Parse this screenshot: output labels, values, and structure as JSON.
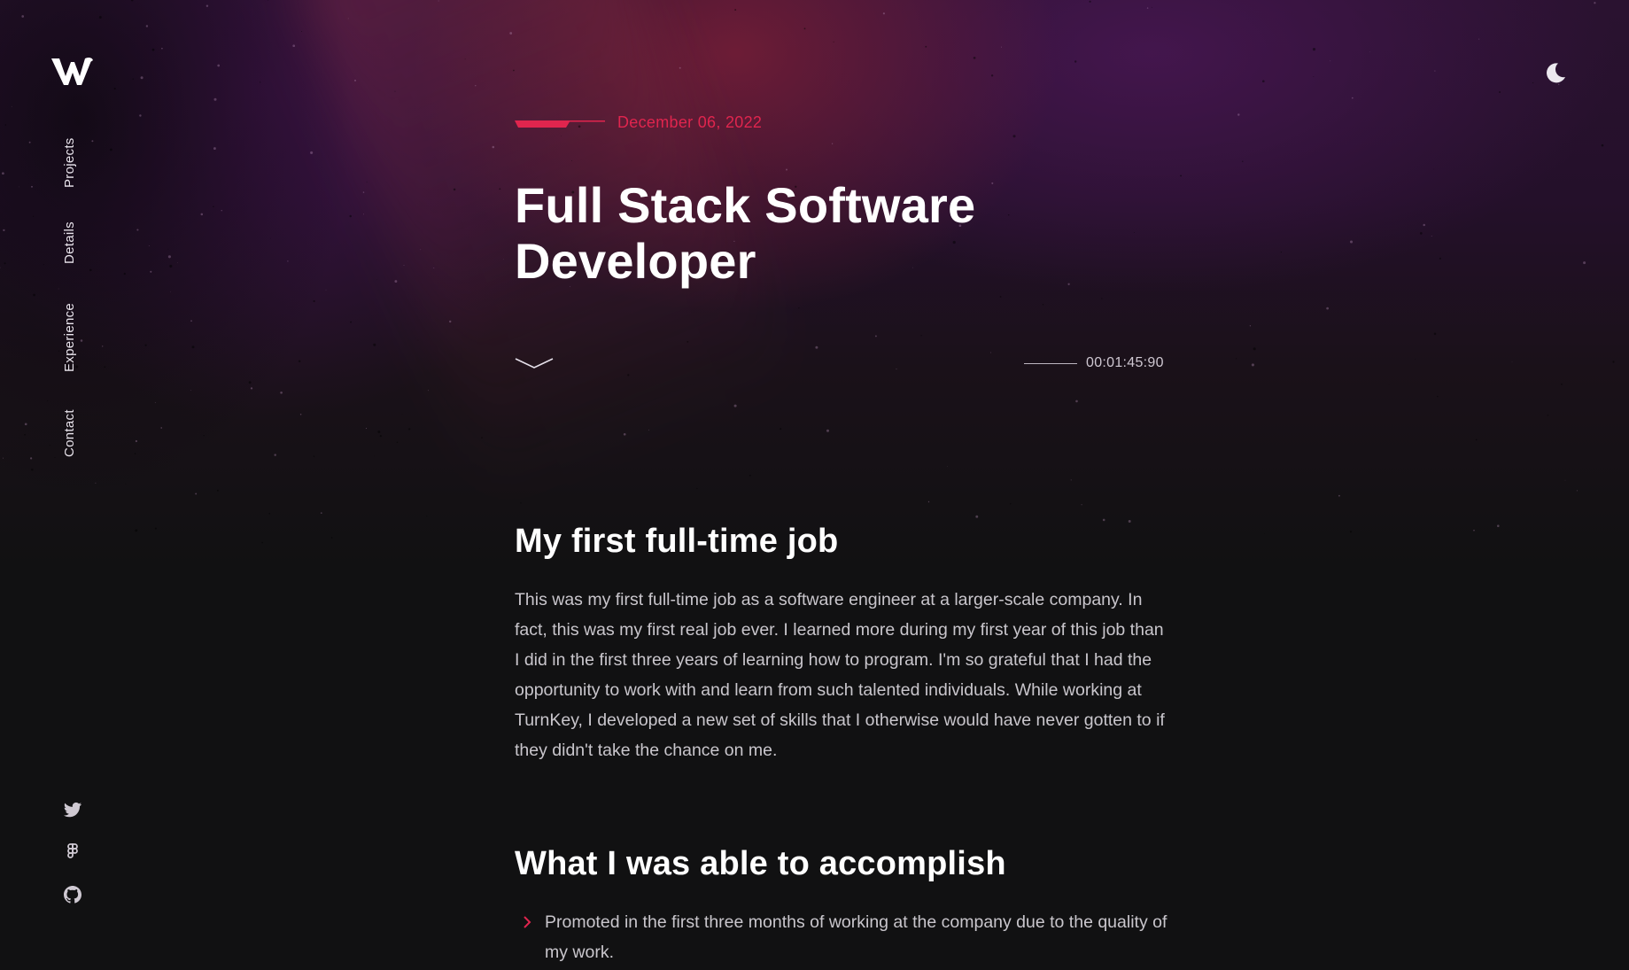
{
  "nav": {
    "logo_alt": "W",
    "items": [
      {
        "label": "Projects"
      },
      {
        "label": "Details"
      },
      {
        "label": "Experience"
      },
      {
        "label": "Contact"
      }
    ],
    "social": [
      "twitter-icon",
      "figma-icon",
      "github-icon"
    ]
  },
  "theme_toggle": {
    "icon": "moon-icon"
  },
  "post": {
    "date": "December 06, 2022",
    "title": "Full Stack Software Developer",
    "reading_time": "00:01:45:90"
  },
  "sections": {
    "first_job": {
      "heading": "My first full-time job",
      "body": "This was my first full-time job as a software engineer at a larger-scale company. In fact, this was my first real job ever. I learned more during my first year of this job than I did in the first three years of learning how to program. I'm so grateful that I had the opportunity to work with and learn from such talented individuals. While working at TurnKey, I developed a new set of skills that I otherwise would have never gotten to if they didn't take the chance on me."
    },
    "accomplish": {
      "heading": "What I was able to accomplish",
      "items": [
        "Promoted in the first three months of working at the company due to the quality of my work."
      ]
    }
  },
  "colors": {
    "accent": "#e0254e",
    "background": "#111112",
    "text": "#c9c6cc"
  }
}
